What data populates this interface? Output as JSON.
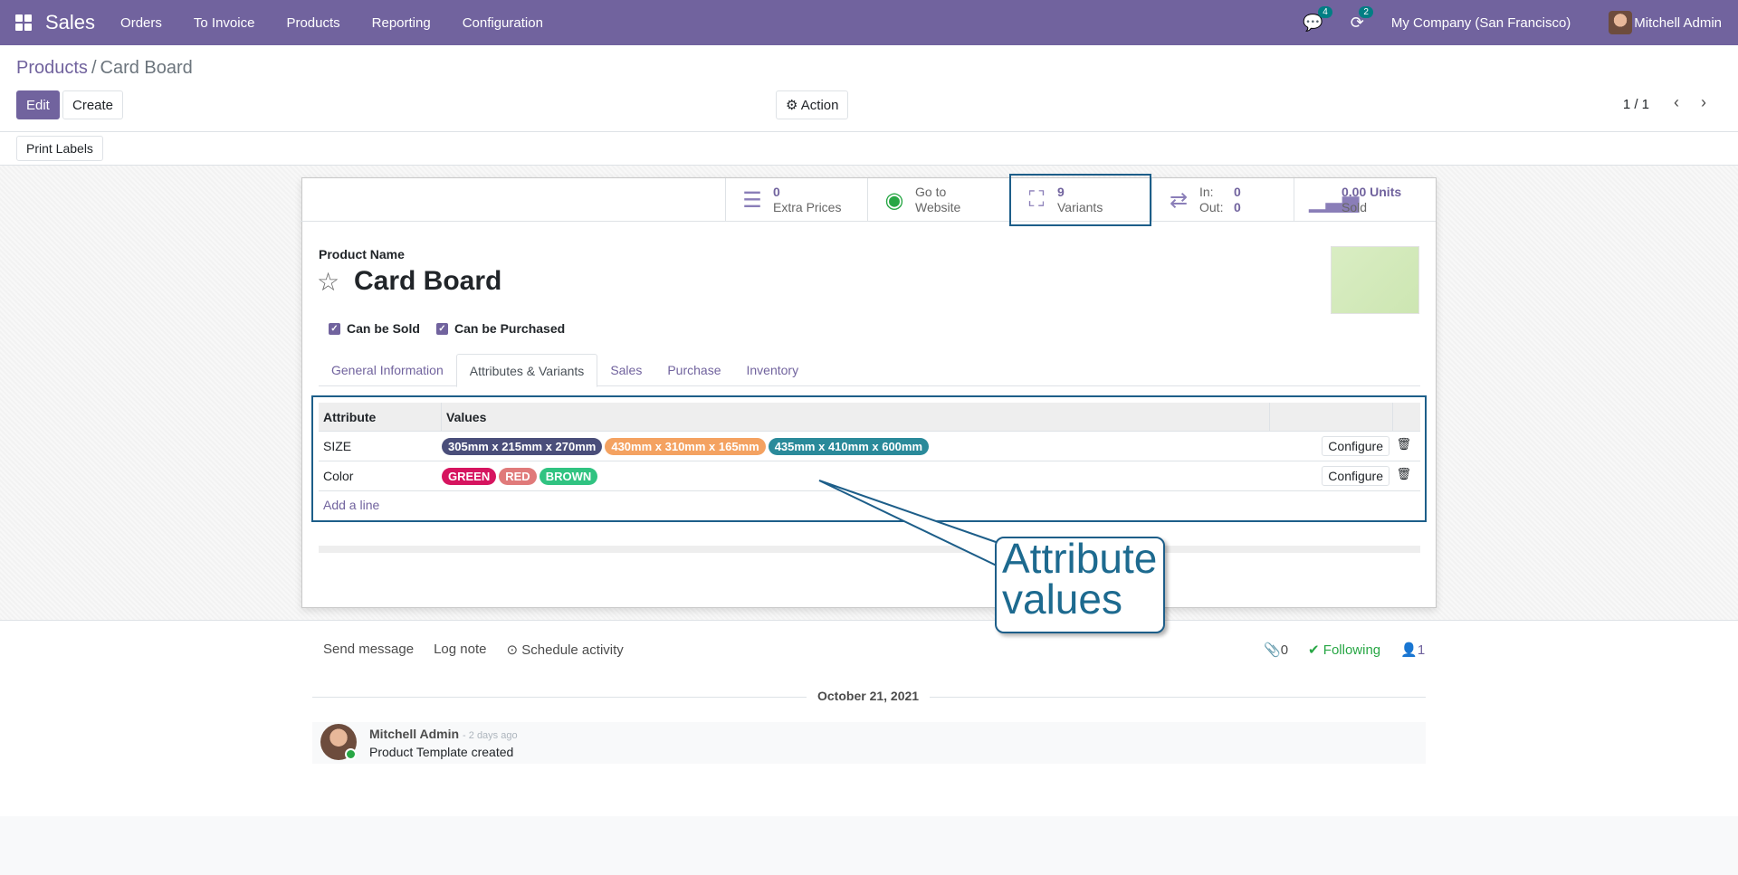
{
  "navbar": {
    "app_name": "Sales",
    "menu": [
      "Orders",
      "To Invoice",
      "Products",
      "Reporting",
      "Configuration"
    ],
    "messages_badge": "4",
    "activities_badge": "2",
    "company": "My Company (San Francisco)",
    "user": "Mitchell Admin"
  },
  "breadcrumb": {
    "parent": "Products",
    "sep": "/",
    "current": "Card Board"
  },
  "toolbar": {
    "edit": "Edit",
    "create": "Create",
    "action": "⚙ Action",
    "print_labels": "Print Labels"
  },
  "pager": {
    "text": "1 / 1"
  },
  "stats": {
    "extra_prices_value": "0",
    "extra_prices_label": "Extra Prices",
    "website_line1": "Go to",
    "website_line2": "Website",
    "variants_value": "9",
    "variants_label": "Variants",
    "in_label": "In:",
    "in_value": "0",
    "out_label": "Out:",
    "out_value": "0",
    "sold_value": "0.00 Units",
    "sold_label": "Sold"
  },
  "product": {
    "name_label": "Product Name",
    "name": "Card Board",
    "can_be_sold": "Can be Sold",
    "can_be_purchased": "Can be Purchased"
  },
  "tabs": [
    "General Information",
    "Attributes & Variants",
    "Sales",
    "Purchase",
    "Inventory"
  ],
  "attributes": {
    "col_attribute": "Attribute",
    "col_values": "Values",
    "rows": [
      {
        "name": "SIZE",
        "values": [
          {
            "label": "305mm x 215mm x 270mm",
            "color": "#4a4e7a"
          },
          {
            "label": "430mm x 310mm x 165mm",
            "color": "#f4a261"
          },
          {
            "label": "435mm x 410mm x 600mm",
            "color": "#2a8a9a"
          }
        ]
      },
      {
        "name": "Color",
        "values": [
          {
            "label": "GREEN",
            "color": "#d6145f"
          },
          {
            "label": "RED",
            "color": "#e07a7a"
          },
          {
            "label": "BROWN",
            "color": "#30c381"
          }
        ]
      }
    ],
    "configure": "Configure",
    "add_line": "Add a line"
  },
  "callout": {
    "line1": "Attribute",
    "line2": "values"
  },
  "chatter": {
    "send_message": "Send message",
    "log_note": "Log note",
    "schedule_activity": "Schedule activity",
    "attachments": "0",
    "following": "Following",
    "followers": "1",
    "date": "October 21, 2021",
    "author": "Mitchell Admin",
    "time": "- 2 days ago",
    "body": "Product Template created"
  }
}
